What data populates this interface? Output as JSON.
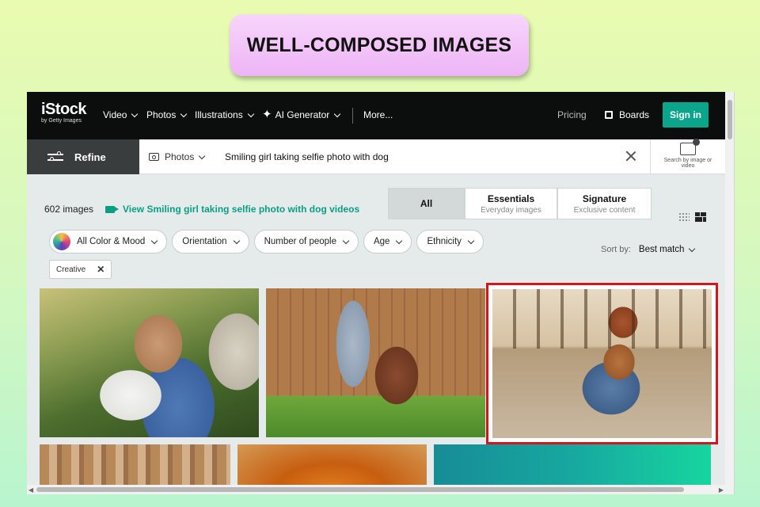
{
  "banner": {
    "title": "WELL-COMPOSED IMAGES"
  },
  "nav": {
    "logo": "iStock",
    "logo_sub": "by Getty Images",
    "items": [
      "Video",
      "Photos",
      "Illustrations",
      "AI Generator",
      "More..."
    ],
    "pricing": "Pricing",
    "boards": "Boards",
    "signin": "Sign in"
  },
  "search": {
    "refine": "Refine",
    "type": "Photos",
    "query": "Smiling girl taking selfie photo with dog",
    "image_search": "Search by image or video"
  },
  "results": {
    "count": "602 images",
    "video_link": "View Smiling girl taking selfie photo with dog videos",
    "segments": [
      {
        "label": "All",
        "sub": ""
      },
      {
        "label": "Essentials",
        "sub": "Everyday images"
      },
      {
        "label": "Signature",
        "sub": "Exclusive content"
      }
    ],
    "filters": [
      "All Color & Mood",
      "Orientation",
      "Number of people",
      "Age",
      "Ethnicity"
    ],
    "sort_label": "Sort by:",
    "sort_value": "Best match",
    "active_tag": "Creative"
  },
  "colors": {
    "accent": "#0aa58b",
    "highlight": "#d6141b",
    "nav_bg": "#0c0d0d"
  }
}
